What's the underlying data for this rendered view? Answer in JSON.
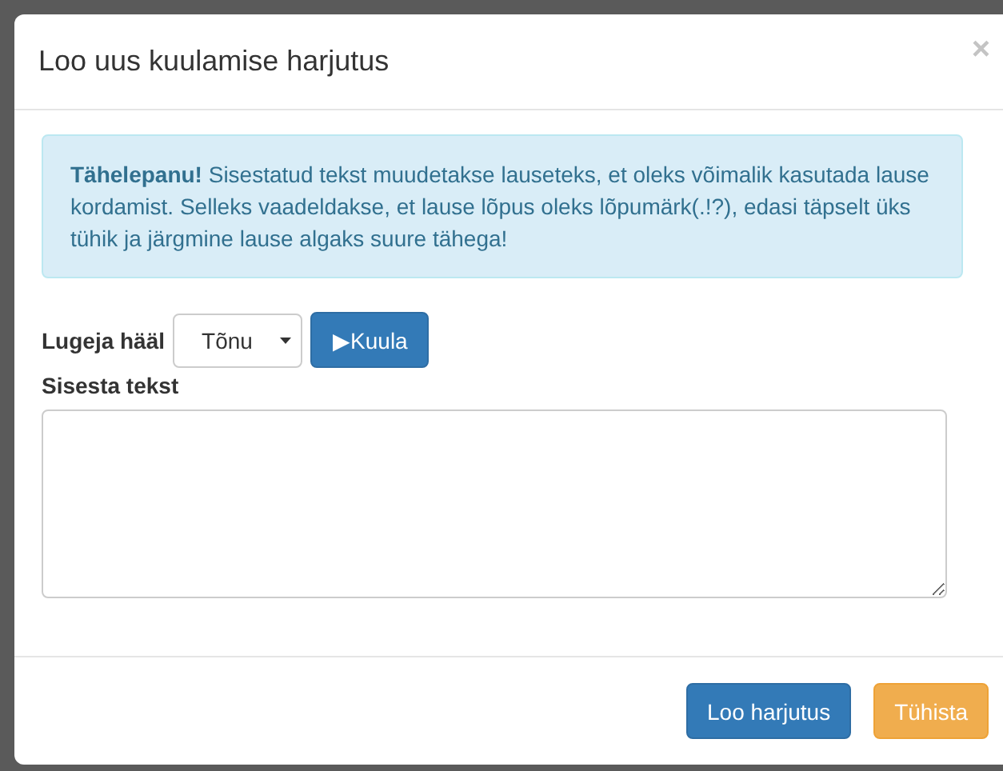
{
  "dialog": {
    "title": "Loo uus kuulamise harjutus",
    "close": "×"
  },
  "alert": {
    "text": "**Tähelepanu!** Sisestatud tekst muudetakse lauseteks, et oleks võimalik kasutada lause kordamist. Selleks vaadeldakse, et lause lõpus oleks lõpumärk(.!?), edasi täpselt üks tühik ja järgmine lause algaks suure tähega!"
  },
  "voice": {
    "label": "Lugeja hääl",
    "value": "Tõnu",
    "play_button": "▶Kuula"
  },
  "text_field": {
    "label": "Sisesta tekst"
  },
  "buttons": [
    {
      "label": "Loo harjutus",
      "kind": "primary"
    },
    {
      "label": "Tühista",
      "kind": "warning"
    }
  ]
}
